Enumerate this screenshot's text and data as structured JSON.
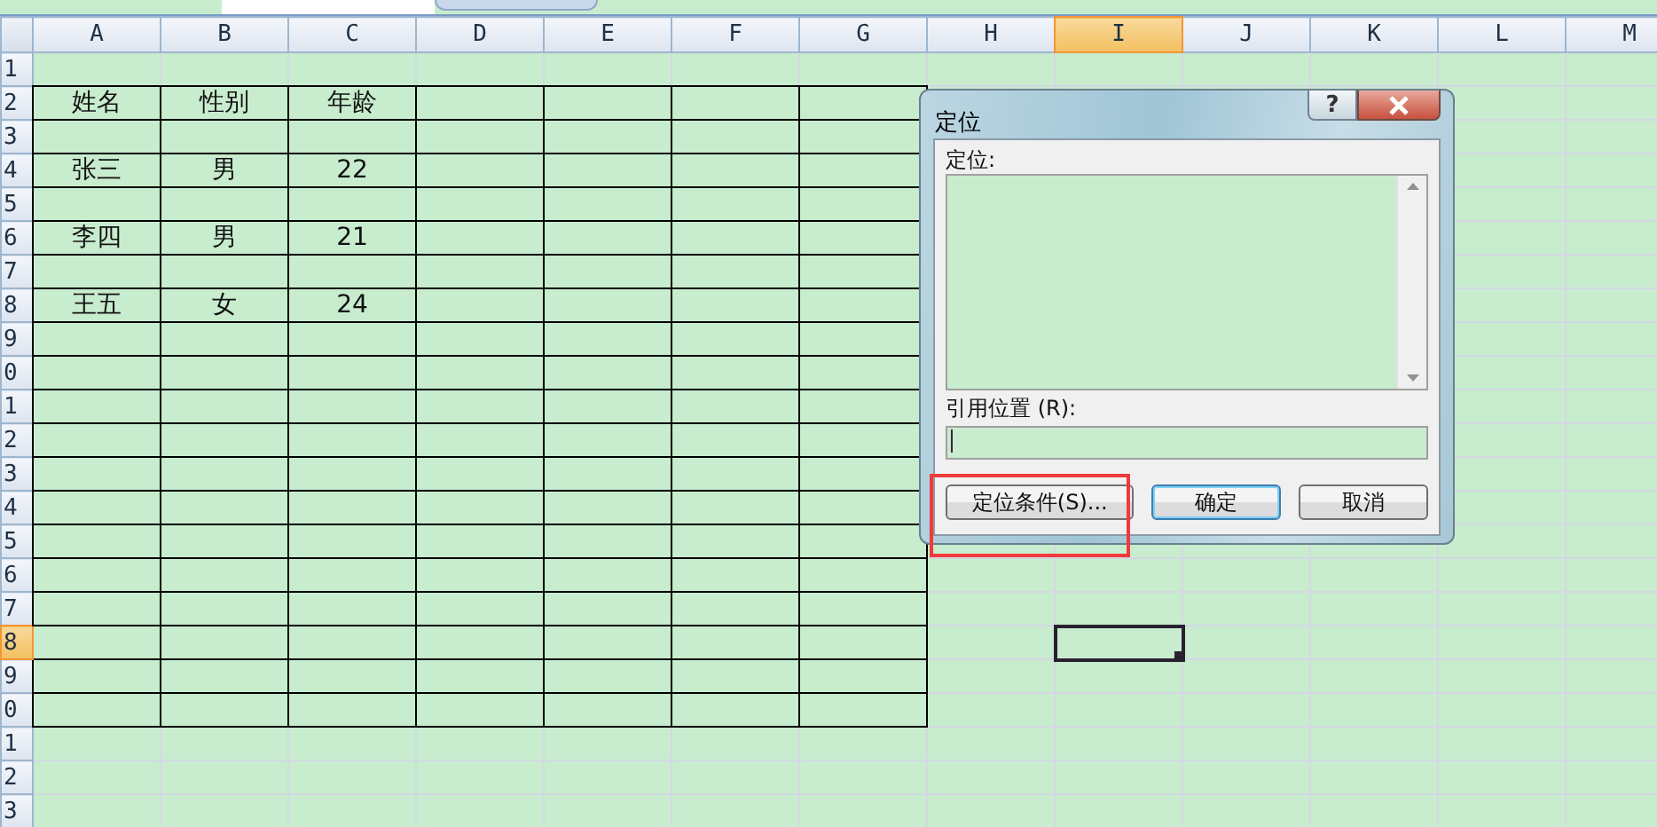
{
  "columns": [
    {
      "label": "A",
      "selected": false
    },
    {
      "label": "B",
      "selected": false
    },
    {
      "label": "C",
      "selected": false
    },
    {
      "label": "D",
      "selected": false
    },
    {
      "label": "E",
      "selected": false
    },
    {
      "label": "F",
      "selected": false
    },
    {
      "label": "G",
      "selected": false
    },
    {
      "label": "H",
      "selected": false
    },
    {
      "label": "I",
      "selected": true
    },
    {
      "label": "J",
      "selected": false
    },
    {
      "label": "K",
      "selected": false
    },
    {
      "label": "L",
      "selected": false
    },
    {
      "label": "M",
      "selected": false
    }
  ],
  "rows": [
    {
      "label": "1",
      "selected": false,
      "bordered": false,
      "cells": []
    },
    {
      "label": "2",
      "selected": false,
      "bordered": true,
      "cells": [
        "姓名",
        "性别",
        "年龄"
      ]
    },
    {
      "label": "3",
      "selected": false,
      "bordered": true,
      "cells": []
    },
    {
      "label": "4",
      "selected": false,
      "bordered": true,
      "cells": [
        "张三",
        "男",
        "22"
      ]
    },
    {
      "label": "5",
      "selected": false,
      "bordered": true,
      "cells": []
    },
    {
      "label": "6",
      "selected": false,
      "bordered": true,
      "cells": [
        "李四",
        "男",
        "21"
      ]
    },
    {
      "label": "7",
      "selected": false,
      "bordered": true,
      "cells": []
    },
    {
      "label": "8",
      "selected": false,
      "bordered": true,
      "cells": [
        "王五",
        "女",
        "24"
      ]
    },
    {
      "label": "9",
      "selected": false,
      "bordered": true,
      "cells": []
    },
    {
      "label": "0",
      "selected": false,
      "bordered": true,
      "cells": []
    },
    {
      "label": "1",
      "selected": false,
      "bordered": true,
      "cells": []
    },
    {
      "label": "2",
      "selected": false,
      "bordered": true,
      "cells": []
    },
    {
      "label": "3",
      "selected": false,
      "bordered": true,
      "cells": []
    },
    {
      "label": "4",
      "selected": false,
      "bordered": true,
      "cells": []
    },
    {
      "label": "5",
      "selected": false,
      "bordered": true,
      "cells": []
    },
    {
      "label": "6",
      "selected": false,
      "bordered": true,
      "cells": []
    },
    {
      "label": "7",
      "selected": false,
      "bordered": true,
      "cells": []
    },
    {
      "label": "8",
      "selected": true,
      "bordered": true,
      "cells": []
    },
    {
      "label": "9",
      "selected": false,
      "bordered": true,
      "cells": []
    },
    {
      "label": "0",
      "selected": false,
      "bordered": true,
      "cells": []
    },
    {
      "label": "1",
      "selected": false,
      "bordered": false,
      "cells": []
    },
    {
      "label": "2",
      "selected": false,
      "bordered": false,
      "cells": []
    },
    {
      "label": "3",
      "selected": false,
      "bordered": false,
      "cells": []
    }
  ],
  "dialog": {
    "title": "定位",
    "help": "?",
    "list_label": "定位:",
    "reference_label": "引用位置 (R):",
    "buttons": [
      {
        "label": "定位条件(S)...",
        "default": false,
        "highlighted": true
      },
      {
        "label": "确定",
        "default": true,
        "highlighted": false
      },
      {
        "label": "取消",
        "default": false,
        "highlighted": false
      }
    ]
  }
}
